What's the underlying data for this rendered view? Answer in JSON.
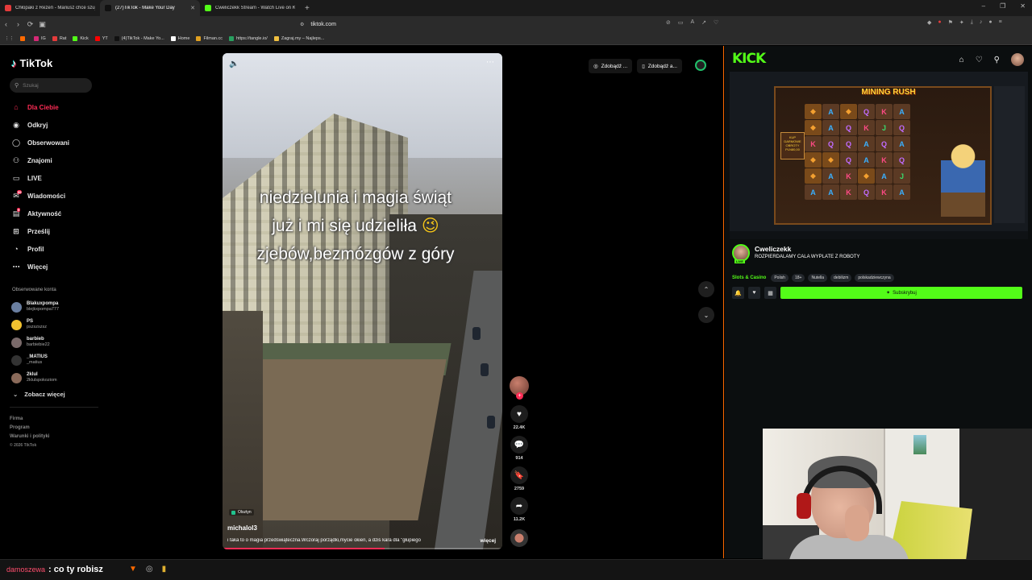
{
  "browser": {
    "tabs": [
      {
        "title": "Chłopaki z Rezeń - Mariusz chce szuj",
        "color": "#e53b3b",
        "active": false
      },
      {
        "title": "(27)TikTok - Make Your Day",
        "color": "#111111",
        "active": true
      },
      {
        "title": "Cweliczekk Stream - Watch Live on K",
        "color": "#53fc18",
        "active": false
      }
    ],
    "new_tab": "+",
    "url": "tiktok.com",
    "bookmarks": [
      {
        "label": "",
        "color": "#ff6a00"
      },
      {
        "label": "IG",
        "color": "#d62976"
      },
      {
        "label": "Rat",
        "color": "#e53b3b"
      },
      {
        "label": "Kick",
        "color": "#53fc18"
      },
      {
        "label": "YT",
        "color": "#ff0000"
      },
      {
        "label": "(4)TikTok - Make Yo...",
        "color": "#111111"
      },
      {
        "label": "Home",
        "color": "#ffffff"
      },
      {
        "label": "Filman.cc",
        "color": "#e0a020"
      },
      {
        "label": "https://tangle.io/",
        "color": "#28a060"
      },
      {
        "label": "Zagraj.my – Najleps...",
        "color": "#f0c040"
      }
    ]
  },
  "tiktok": {
    "brand": "TikTok",
    "search_placeholder": "Szukaj",
    "nav": [
      {
        "label": "Dla Ciebie",
        "icon": "home-icon",
        "active": true
      },
      {
        "label": "Odkryj",
        "icon": "compass-icon"
      },
      {
        "label": "Obserwowani",
        "icon": "following-icon"
      },
      {
        "label": "Znajomi",
        "icon": "friends-icon"
      },
      {
        "label": "LIVE",
        "icon": "live-icon"
      },
      {
        "label": "Wiadomości",
        "icon": "messages-icon",
        "badge": "99"
      },
      {
        "label": "Aktywność",
        "icon": "activity-icon",
        "badge": "9"
      },
      {
        "label": "Prześlij",
        "icon": "upload-icon"
      },
      {
        "label": "Profil",
        "icon": "profile-icon"
      },
      {
        "label": "Więcej",
        "icon": "more-icon"
      }
    ],
    "following_title": "Obserwowane konta",
    "following": [
      {
        "name": "Blakuxpompa",
        "handle": "blejkxpompa777"
      },
      {
        "name": "PS",
        "handle": "pszszszsz"
      },
      {
        "name": "barbieb",
        "handle": "barbiebie22"
      },
      {
        "name": "_MATIUS",
        "handle": "_matius"
      },
      {
        "name": "2klul",
        "handle": "2klulspokoziom"
      }
    ],
    "see_more": "Zobacz więcej",
    "footer": [
      "Firma",
      "Program",
      "Warunki i polityki"
    ],
    "copyright": "© 2026 TikTok",
    "video": {
      "caption_lines": [
        "niedzielunia i magia świąt",
        "już i mi się udzieliła",
        "zjebów,bezmózgów z góry"
      ],
      "caption_emoji": "😉",
      "location": "Olsztyn",
      "author": "michalol3",
      "description": "i taka to o magia przedświąteczna.Wczoraj porządki,mycie okien, a dziś kara dla \"głupiego",
      "more": "więcej",
      "progress": 0.58
    },
    "actions": [
      {
        "icon": "heart-icon",
        "count": "22.4K"
      },
      {
        "icon": "comment-icon",
        "count": "914"
      },
      {
        "icon": "bookmark-icon",
        "count": "2759"
      },
      {
        "icon": "share-icon",
        "count": "11.2K"
      }
    ],
    "top_pills": [
      "Zdobądź ...",
      "Zdobądź a..."
    ]
  },
  "kick": {
    "brand": "KICK",
    "streamer": "Cweliczekk",
    "live_badge": "LIVE",
    "stream_title": "ROZPIERDALAMY CALA WYPLATE Z ROBOTY",
    "category": "Slots & Casino",
    "tags": [
      "Polish",
      "18+",
      "Nutella",
      "debilizm",
      "polskadziewczyna"
    ],
    "subscribe_label": "Subskrybuj",
    "slot": {
      "title": "MINING RUSH",
      "buy_label": "KUP DARMOWE OBROTY",
      "buy_price": "PLN80,00",
      "rows": [
        [
          "g",
          "a",
          "g",
          "q",
          "k",
          "a"
        ],
        [
          "g",
          "a",
          "q",
          "k",
          "j",
          "q"
        ],
        [
          "k",
          "q",
          "q",
          "a",
          "q",
          "a"
        ],
        [
          "g",
          "g",
          "q",
          "a",
          "k",
          "q"
        ],
        [
          "g",
          "a",
          "k",
          "g",
          "a",
          "j"
        ],
        [
          "a",
          "a",
          "k",
          "q",
          "k",
          "a"
        ]
      ]
    }
  },
  "taskbar": {
    "ticker_handle": "damoszewa",
    "ticker_text": ": co ty robisz"
  }
}
